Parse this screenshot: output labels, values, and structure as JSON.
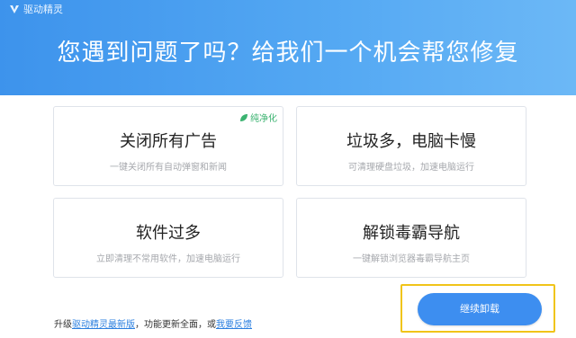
{
  "window": {
    "app_title": "驱动精灵"
  },
  "header": {
    "headline": "您遇到问题了吗？给我们一个机会帮您修复",
    "bg_color": "#4a9ef0"
  },
  "cards": [
    {
      "title": "关闭所有广告",
      "desc": "一键关闭所有自动弹窗和新闻",
      "badge": "纯净化"
    },
    {
      "title": "垃圾多，电脑卡慢",
      "desc": "可清理硬盘垃圾，加速电脑运行"
    },
    {
      "title": "软件过多",
      "desc": "立即清理不常用软件，加速电脑运行"
    },
    {
      "title": "解锁毒霸导航",
      "desc": "一键解锁浏览器毒霸导航主页"
    }
  ],
  "footer": {
    "prefix": "升级",
    "upgrade_link": "驱动精灵最新版",
    "middle": "，功能更新全面，或",
    "feedback_link": "我要反馈"
  },
  "uninstall_button": {
    "label": "继续卸载",
    "highlight_color": "#f0c419"
  }
}
